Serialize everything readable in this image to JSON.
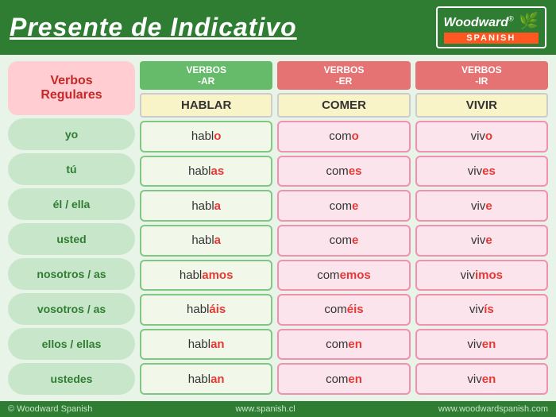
{
  "header": {
    "title": "Presente de Indicativo",
    "logo": {
      "brand": "Woodward",
      "reg": "®",
      "sub": "SPANISH"
    }
  },
  "table": {
    "verbos_regulares": "Verbos\nRegulares",
    "columns": [
      {
        "id": "ar",
        "label_top": "VERBOS",
        "label_type": "-AR",
        "infinitive": "HABLAR",
        "class": "ar"
      },
      {
        "id": "er",
        "label_top": "VERBOS",
        "label_type": "-ER",
        "infinitive": "COMER",
        "class": "er"
      },
      {
        "id": "ir",
        "label_top": "VERBOS",
        "label_type": "-IR",
        "infinitive": "VIVIR",
        "class": "ir"
      }
    ],
    "rows": [
      {
        "subject": "yo",
        "ar_stem": "habl",
        "ar_end": "o",
        "er_stem": "com",
        "er_end": "o",
        "ir_stem": "viv",
        "ir_end": "o"
      },
      {
        "subject": "tú",
        "ar_stem": "habl",
        "ar_end": "as",
        "er_stem": "com",
        "er_end": "es",
        "ir_stem": "viv",
        "ir_end": "es"
      },
      {
        "subject": "él / ella",
        "ar_stem": "habl",
        "ar_end": "a",
        "er_stem": "com",
        "er_end": "e",
        "ir_stem": "viv",
        "ir_end": "e"
      },
      {
        "subject": "usted",
        "ar_stem": "habl",
        "ar_end": "a",
        "er_stem": "com",
        "er_end": "e",
        "ir_stem": "viv",
        "ir_end": "e"
      },
      {
        "subject": "nosotros / as",
        "ar_stem": "habl",
        "ar_end": "amos",
        "er_stem": "com",
        "er_end": "emos",
        "ir_stem": "viv",
        "ir_end": "imos"
      },
      {
        "subject": "vosotros / as",
        "ar_stem": "habl",
        "ar_end": "áis",
        "er_stem": "com",
        "er_end": "éis",
        "ir_stem": "viv",
        "ir_end": "ís"
      },
      {
        "subject": "ellos / ellas",
        "ar_stem": "habl",
        "ar_end": "an",
        "er_stem": "com",
        "er_end": "en",
        "ir_stem": "viv",
        "ir_end": "en"
      },
      {
        "subject": "ustedes",
        "ar_stem": "habl",
        "ar_end": "an",
        "er_stem": "com",
        "er_end": "en",
        "ir_stem": "viv",
        "ir_end": "en"
      }
    ]
  },
  "footer": {
    "left": "© Woodward Spanish",
    "center": "www.spanish.cl",
    "right": "www.woodwardspanish.com"
  }
}
